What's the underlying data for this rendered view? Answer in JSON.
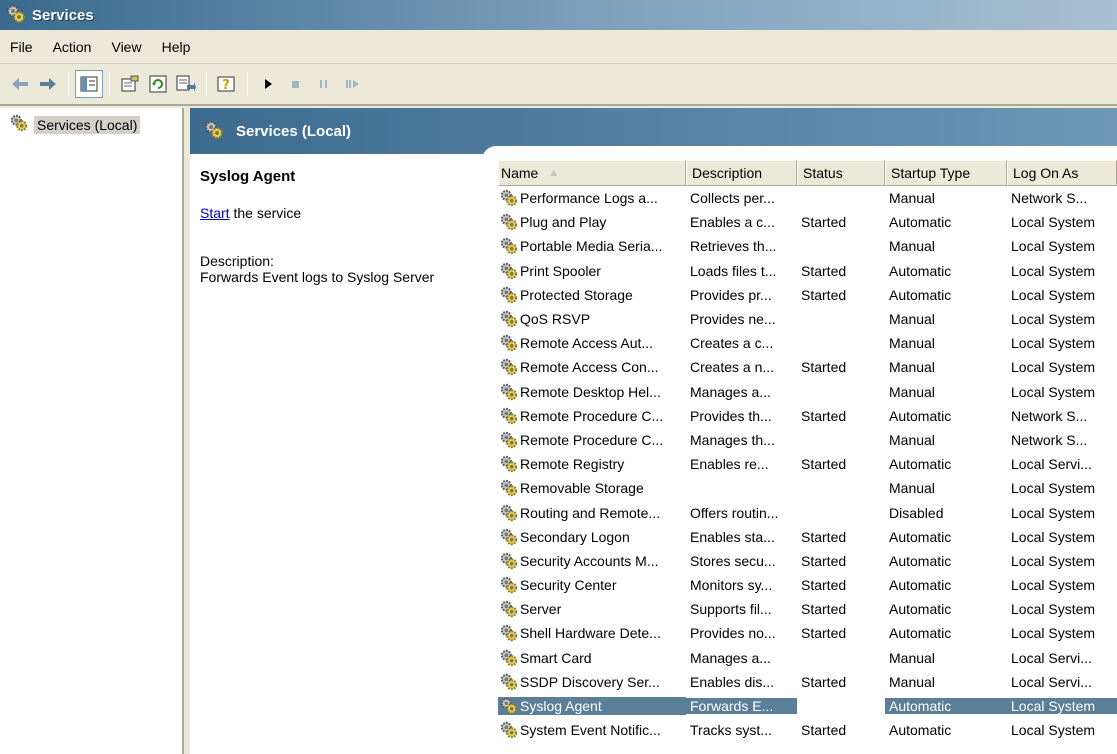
{
  "window": {
    "title": "Services",
    "icon": "gears-icon"
  },
  "menu": [
    "File",
    "Action",
    "View",
    "Help"
  ],
  "toolbar": {
    "buttons": [
      "back-icon",
      "forward-icon",
      "show-hide-tree-icon",
      "properties-icon",
      "refresh-icon",
      "export-list-icon",
      "help-icon",
      "play-icon",
      "stop-icon",
      "pause-icon",
      "restart-icon"
    ]
  },
  "tree": {
    "label": "Services (Local)"
  },
  "header": {
    "title": "Services (Local)"
  },
  "details": {
    "service_name": "Syslog Agent",
    "start_link": "Start",
    "start_suffix": " the service",
    "description_label": "Description:",
    "description_text": "Forwards Event logs to Syslog Server"
  },
  "table": {
    "columns": [
      "Name",
      "Description",
      "Status",
      "Startup Type",
      "Log On As"
    ],
    "sort_indicator": "▲",
    "selected_row": 21,
    "rows": [
      [
        "Performance Logs a...",
        "Collects per...",
        "",
        "Manual",
        "Network S..."
      ],
      [
        "Plug and Play",
        "Enables a c...",
        "Started",
        "Automatic",
        "Local System"
      ],
      [
        "Portable Media Seria...",
        "Retrieves th...",
        "",
        "Manual",
        "Local System"
      ],
      [
        "Print Spooler",
        "Loads files t...",
        "Started",
        "Automatic",
        "Local System"
      ],
      [
        "Protected Storage",
        "Provides pr...",
        "Started",
        "Automatic",
        "Local System"
      ],
      [
        "QoS RSVP",
        "Provides ne...",
        "",
        "Manual",
        "Local System"
      ],
      [
        "Remote Access Aut...",
        "Creates a c...",
        "",
        "Manual",
        "Local System"
      ],
      [
        "Remote Access Con...",
        "Creates a n...",
        "Started",
        "Manual",
        "Local System"
      ],
      [
        "Remote Desktop Hel...",
        "Manages a...",
        "",
        "Manual",
        "Local System"
      ],
      [
        "Remote Procedure C...",
        "Provides th...",
        "Started",
        "Automatic",
        "Network S..."
      ],
      [
        "Remote Procedure C...",
        "Manages th...",
        "",
        "Manual",
        "Network S..."
      ],
      [
        "Remote Registry",
        "Enables re...",
        "Started",
        "Automatic",
        "Local Servi..."
      ],
      [
        "Removable Storage",
        "",
        "",
        "Manual",
        "Local System"
      ],
      [
        "Routing and Remote...",
        "Offers routin...",
        "",
        "Disabled",
        "Local System"
      ],
      [
        "Secondary Logon",
        "Enables sta...",
        "Started",
        "Automatic",
        "Local System"
      ],
      [
        "Security Accounts M...",
        "Stores secu...",
        "Started",
        "Automatic",
        "Local System"
      ],
      [
        "Security Center",
        "Monitors sy...",
        "Started",
        "Automatic",
        "Local System"
      ],
      [
        "Server",
        "Supports fil...",
        "Started",
        "Automatic",
        "Local System"
      ],
      [
        "Shell Hardware Dete...",
        "Provides no...",
        "Started",
        "Automatic",
        "Local System"
      ],
      [
        "Smart Card",
        "Manages a...",
        "",
        "Manual",
        "Local Servi..."
      ],
      [
        "SSDP Discovery Ser...",
        "Enables dis...",
        "Started",
        "Manual",
        "Local Servi..."
      ],
      [
        "Syslog Agent",
        "Forwards E...",
        "",
        "Automatic",
        "Local System"
      ],
      [
        "System Event Notific...",
        "Tracks syst...",
        "Started",
        "Automatic",
        "Local System"
      ]
    ]
  }
}
